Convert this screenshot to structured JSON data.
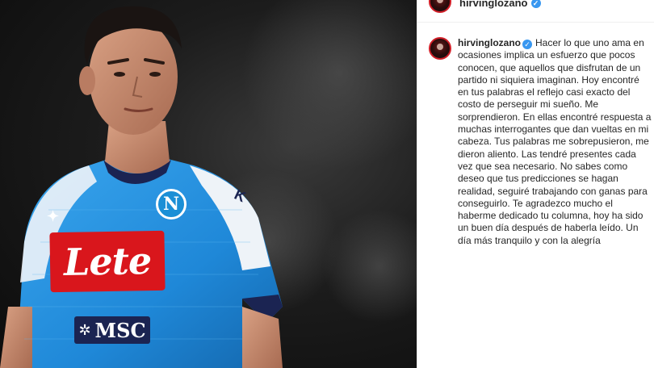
{
  "photo": {
    "sponsor_main": "Lete",
    "sponsor_sub": "MSC",
    "crest_letter": "N",
    "kit_brand": "Kappa"
  },
  "header": {
    "username": "hirvinglozano",
    "verified_icon": "verified-badge-icon"
  },
  "comment": {
    "username": "hirvinglozano",
    "text": "Hacer lo que uno ama en ocasiones implica un esfuerzo que pocos conocen, que aquellos que disfrutan de un partido ni siquiera imaginan. Hoy encontré en tus palabras el reflejo casi exacto del costo de perseguir mi sueño. Me sorprendieron. En ellas encontré respuesta a muchas interrogantes que dan vueltas en mi cabeza. Tus palabras me sobrepusieron, me dieron aliento. Las tendré presentes cada vez que sea necesario. No sabes como deseo que tus predicciones se hagan realidad, seguiré trabajando con ganas para conseguirlo. Te agradezco mucho el haberme dedicado tu columna, hoy ha sido un buen día después de haberla leído. Un día más tranquilo y con la alegría"
  },
  "colors": {
    "jersey_blue": "#1f8fe0",
    "sponsor_red": "#d9161c",
    "verified_blue": "#3897f0",
    "text_dark": "#262626"
  }
}
